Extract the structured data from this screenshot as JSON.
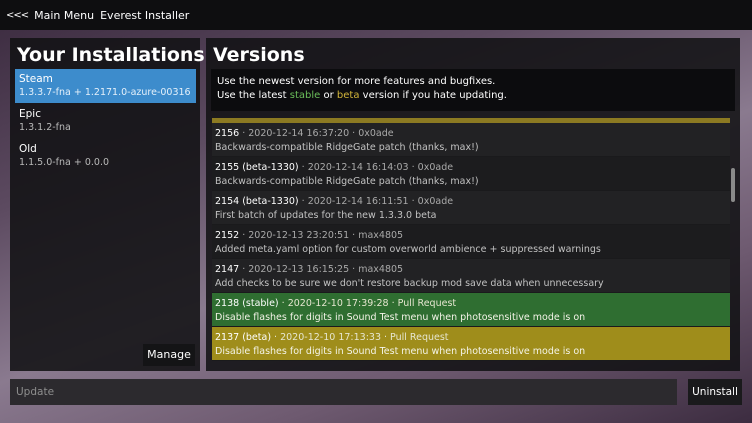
{
  "topbar": {
    "back_glyph": "<<<",
    "main_menu": "Main Menu",
    "title": "Everest Installer"
  },
  "installations": {
    "title": "Your Installations",
    "items": [
      {
        "name": "Steam",
        "version": "1.3.3.7-fna + 1.2171.0-azure-00316",
        "selected": true
      },
      {
        "name": "Epic",
        "version": "1.3.1.2-fna",
        "selected": false
      },
      {
        "name": "Old",
        "version": "1.1.5.0-fna + 0.0.0",
        "selected": false
      }
    ],
    "manage_label": "Manage"
  },
  "versions": {
    "title": "Versions",
    "info_line1": "Use the newest version for more features and bugfixes.",
    "info_line2_prefix": "Use the latest",
    "info_stable": "stable",
    "info_or": "or",
    "info_beta": "beta",
    "info_line2_suffix": "version if you hate updating.",
    "items": [
      {
        "num": "2156",
        "meta": "2020-12-14 16:37:20 · 0x0ade",
        "desc": "Backwards-compatible RidgeGate patch (thanks, max!)",
        "kind": "normal"
      },
      {
        "num": "2155 (beta-1330)",
        "meta": "2020-12-14 16:14:03 · 0x0ade",
        "desc": "Backwards-compatible RidgeGate patch (thanks, max!)",
        "kind": "normal"
      },
      {
        "num": "2154 (beta-1330)",
        "meta": "2020-12-14 16:11:51 · 0x0ade",
        "desc": "First batch of updates for the new 1.3.3.0 beta",
        "kind": "normal"
      },
      {
        "num": "2152",
        "meta": "2020-12-13 23:20:51 · max4805",
        "desc": "Added meta.yaml option for custom overworld ambience + suppressed warnings",
        "kind": "normal"
      },
      {
        "num": "2147",
        "meta": "2020-12-13 16:15:25 · max4805",
        "desc": "Add checks to be sure we don't restore backup mod save data when unnecessary",
        "kind": "normal"
      },
      {
        "num": "2138 (stable)",
        "meta": "2020-12-10 17:39:28 · Pull Request",
        "desc": "Disable flashes for digits in Sound Test menu when photosensitive mode is on",
        "kind": "stable"
      },
      {
        "num": "2137 (beta)",
        "meta": "2020-12-10 17:13:33 · Pull Request",
        "desc": "Disable flashes for digits in Sound Test menu when photosensitive mode is on",
        "kind": "beta"
      }
    ]
  },
  "footer": {
    "update_placeholder": "Update",
    "uninstall_label": "Uninstall"
  }
}
